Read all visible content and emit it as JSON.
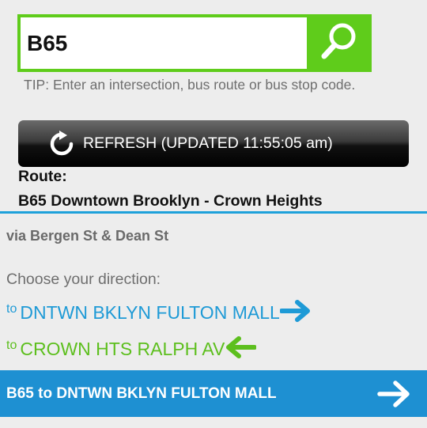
{
  "search": {
    "value": "B65",
    "button_icon": "search-icon"
  },
  "tip": "TIP: Enter an intersection, bus route or bus stop code.",
  "refresh": {
    "icon": "refresh-icon",
    "label": "REFRESH (UPDATED 11:55:05 am)"
  },
  "route": {
    "label": "Route:",
    "name": "B65 Downtown Brooklyn - Crown Heights",
    "via": "via Bergen St & Dean St"
  },
  "directions": {
    "prompt": "Choose your direction:",
    "items": [
      {
        "to": "to",
        "destination": "DNTWN BKLYN FULTON MALL",
        "arrow": "arrow-right-icon",
        "color": "#1e9ad6"
      },
      {
        "to": "to",
        "destination": "CROWN HTS RALPH AV",
        "arrow": "arrow-left-icon",
        "color": "#5dbf1e"
      }
    ]
  },
  "banner": {
    "label": "B65 to DNTWN BKLYN FULTON MALL",
    "arrow": "arrow-right-icon"
  },
  "colors": {
    "search_green": "#5fcc1b",
    "divider_blue": "#1ea1da",
    "banner_blue": "#1e90d2"
  }
}
